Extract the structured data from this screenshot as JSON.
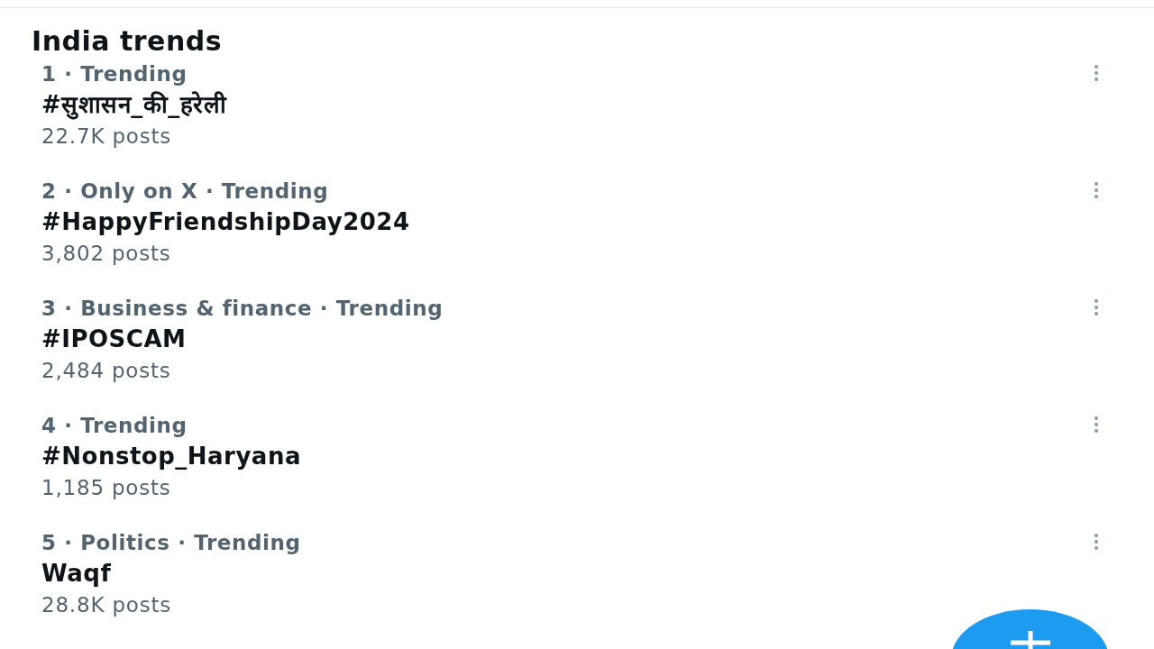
{
  "heading": "India trends",
  "trends": [
    {
      "meta": "1 · Trending",
      "title": "#सुशासन_की_हरेली",
      "count": "22.7K posts"
    },
    {
      "meta": "2 · Only on X · Trending",
      "title": "#HappyFriendshipDay2024",
      "count": "3,802 posts"
    },
    {
      "meta": "3 · Business & finance · Trending",
      "title": "#IPOSCAM",
      "count": "2,484 posts"
    },
    {
      "meta": "4 · Trending",
      "title": "#Nonstop_Haryana",
      "count": "1,185 posts"
    },
    {
      "meta": "5 · Politics · Trending",
      "title": "Waqf",
      "count": "28.8K posts"
    }
  ]
}
